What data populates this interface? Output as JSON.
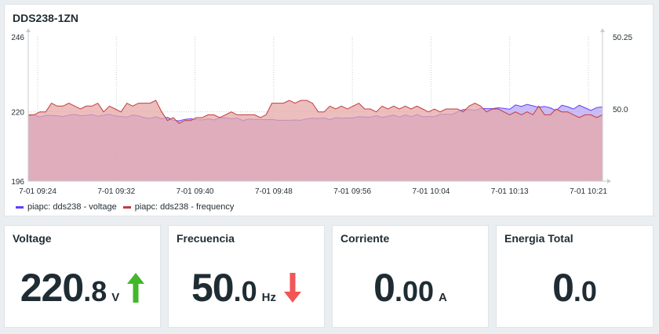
{
  "chart_panel": {
    "title": "DDS238-1ZN"
  },
  "chart_data": {
    "type": "area",
    "x": [
      "7-01 09:24",
      "7-01 09:32",
      "7-01 09:40",
      "7-01 09:48",
      "7-01 09:56",
      "7-01 10:04",
      "7-01 10:13",
      "7-01 10:21"
    ],
    "left_axis": {
      "min": 196,
      "max": 246,
      "ticks": [
        "246",
        "220",
        "196"
      ]
    },
    "right_axis": {
      "min": 49.75,
      "max": 50.25,
      "ticks": [
        "50.25",
        "50.0"
      ]
    },
    "grid": true,
    "legend_position": "bottom-left",
    "series": [
      {
        "name": "piapc: dds238 - voltage",
        "axis": "left",
        "color": "#5b3fff",
        "fill": "#b9a6f3",
        "values": [
          218.6,
          219.0,
          218.2,
          218.8,
          218.8,
          218.6,
          218.4,
          218.9,
          219.1,
          218.7,
          218.8,
          219.1,
          218.5,
          218.9,
          219.2,
          218.6,
          218.4,
          218.2,
          218.9,
          218.6,
          218.0,
          217.7,
          218.3,
          217.6,
          218.1,
          217.1,
          216.9,
          217.4,
          217.6,
          217.3,
          217.2,
          217.6,
          217.2,
          217.9,
          218.0,
          217.6,
          217.9,
          217.0,
          217.5,
          217.4,
          217.4,
          217.3,
          217.4,
          217.1,
          217.1,
          217.1,
          217.2,
          217.1,
          217.6,
          217.8,
          217.7,
          217.9,
          217.3,
          218.0,
          217.8,
          217.9,
          217.9,
          218.4,
          218.2,
          218.2,
          218.7,
          218.1,
          218.5,
          218.9,
          218.2,
          219.0,
          218.3,
          219.1,
          218.3,
          218.4,
          218.3,
          219.1,
          219.2,
          219.1,
          220.0,
          220.8,
          220.8,
          220.5,
          221.2,
          221.1,
          221.1,
          221.4,
          221.2,
          220.9,
          222.4,
          221.9,
          222.6,
          222.1,
          221.6,
          221.9,
          221.4,
          220.4,
          222.3,
          221.8,
          221.0,
          222.3,
          221.4,
          220.5,
          221.5,
          221.7
        ]
      },
      {
        "name": "piapc: dds238 - frequency",
        "axis": "right",
        "color": "#c43c3c",
        "fill": "#e6a8a8",
        "values": [
          49.98,
          49.98,
          49.99,
          49.99,
          50.02,
          50.01,
          50.01,
          50.02,
          50.01,
          50.0,
          50.01,
          50.01,
          50.02,
          49.99,
          50.01,
          50.0,
          49.99,
          50.02,
          50.01,
          50.02,
          50.02,
          50.02,
          50.03,
          49.99,
          49.96,
          49.97,
          49.95,
          49.96,
          49.96,
          49.97,
          49.97,
          49.98,
          49.98,
          49.97,
          49.98,
          49.99,
          49.98,
          49.98,
          49.98,
          49.98,
          49.97,
          49.98,
          50.02,
          50.02,
          50.02,
          50.03,
          50.02,
          50.03,
          50.03,
          50.02,
          49.99,
          49.99,
          50.01,
          50.0,
          50.01,
          50.0,
          50.01,
          50.02,
          50.0,
          50.0,
          49.99,
          50.01,
          50.0,
          50.01,
          50.0,
          50.01,
          50.0,
          50.01,
          50.0,
          49.99,
          50.0,
          49.99,
          50.0,
          50.0,
          50.0,
          49.99,
          50.01,
          50.02,
          50.01,
          49.99,
          50.0,
          50.0,
          49.99,
          49.98,
          49.99,
          49.98,
          49.99,
          49.98,
          50.01,
          49.98,
          49.98,
          50.0,
          49.99,
          49.99,
          49.98,
          49.97,
          49.98,
          49.98,
          49.97,
          49.98
        ]
      }
    ]
  },
  "stats": [
    {
      "title": "Voltage",
      "int": "220",
      "dec": ".8",
      "unit": "V",
      "trend": "up",
      "trend_color": "#43b72b"
    },
    {
      "title": "Frecuencia",
      "int": "50",
      "dec": ".0",
      "unit": "Hz",
      "trend": "down",
      "trend_color": "#f25656"
    },
    {
      "title": "Corriente",
      "int": "0",
      "dec": ".00",
      "unit": "A",
      "trend": "none"
    },
    {
      "title": "Energia Total",
      "int": "0",
      "dec": ".0",
      "unit": "",
      "trend": "none"
    }
  ]
}
